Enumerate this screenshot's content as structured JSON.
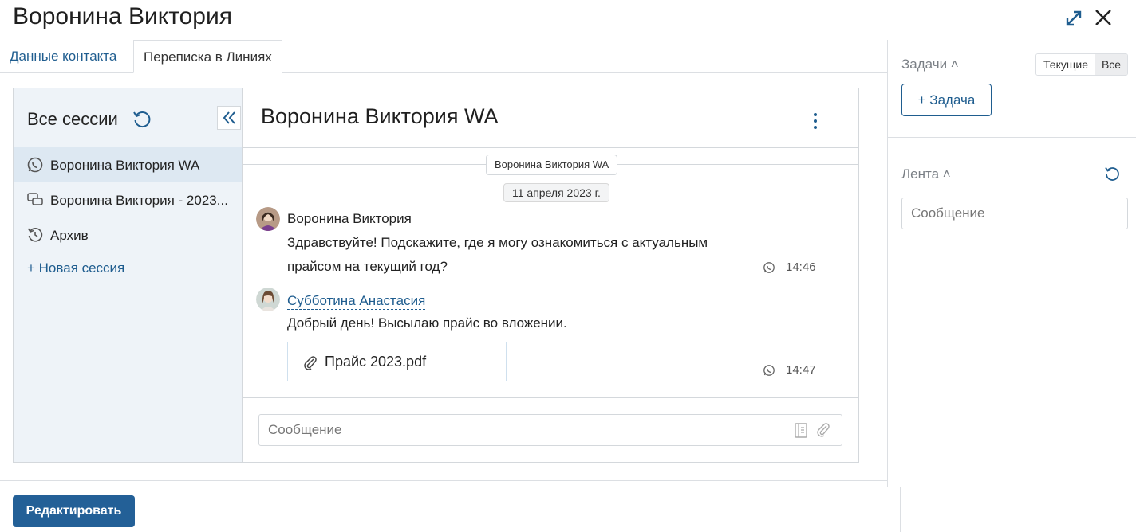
{
  "header": {
    "title": "Воронина Виктория"
  },
  "tabs": [
    {
      "label": "Данные контакта"
    },
    {
      "label": "Переписка в Линиях"
    }
  ],
  "sessions": {
    "title": "Все сессии",
    "items": [
      {
        "label": "Воронина Виктория WA",
        "icon": "whatsapp-icon",
        "active": true
      },
      {
        "label": "Воронина Виктория - 2023...",
        "icon": "chat-bubbles-icon",
        "active": false
      },
      {
        "label": "Архив",
        "icon": "history-icon",
        "active": false
      }
    ],
    "new_session": "+ Новая сессия"
  },
  "chat": {
    "title": "Воронина Виктория WA",
    "session_chip": "Воронина Виктория WA",
    "date": "11 апреля 2023 г.",
    "messages": [
      {
        "author": "Воронина Виктория",
        "line1": "Здравствуйте! Подскажите, где я могу ознакомиться с актуальным",
        "line2": "прайсом на текущий год?",
        "time": "14:46"
      },
      {
        "author": "Субботина Анастасия",
        "text": "Добрый день! Высылаю прайс во вложении.",
        "attachment": "Прайс 2023.pdf",
        "time": "14:47"
      }
    ],
    "input_placeholder": "Сообщение"
  },
  "footer": {
    "edit_label": "Редактировать"
  },
  "side": {
    "tasks_title": "Задачи ˄",
    "toggle_current": "Текущие",
    "toggle_all": "Все",
    "add_task": "+ Задача",
    "feed_title": "Лента ˄",
    "feed_placeholder": "Сообщение"
  },
  "colors": {
    "accent": "#1f5d8f",
    "primary_button": "#236097",
    "sessions_bg": "#eef3f8",
    "active_session_bg": "#dde8f2"
  }
}
